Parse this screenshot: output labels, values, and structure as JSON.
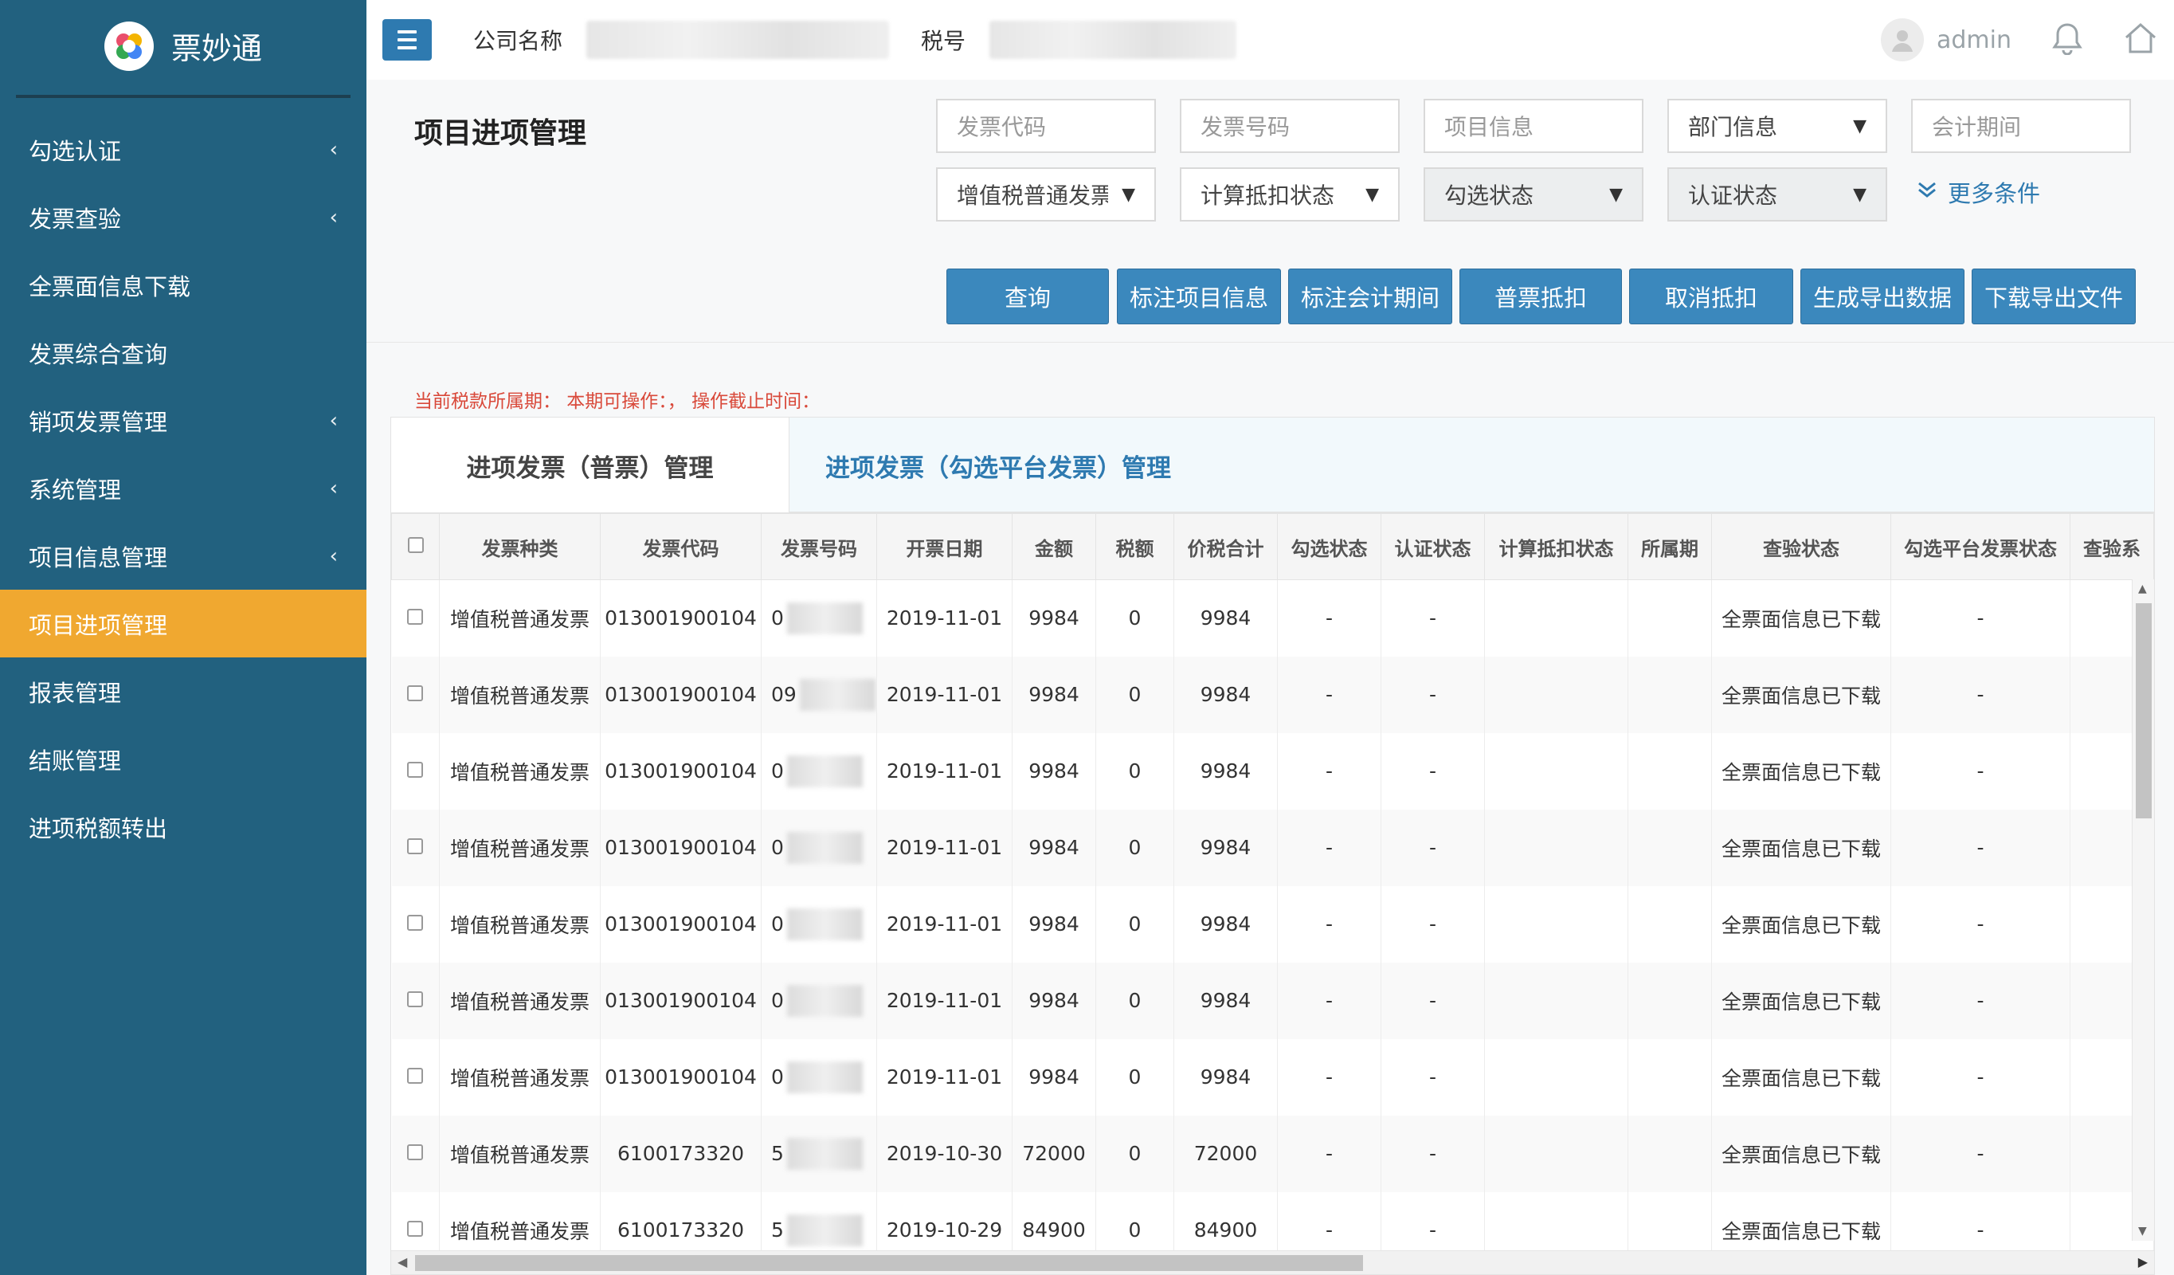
{
  "app": {
    "name": "票妙通"
  },
  "sidebar": {
    "items": [
      {
        "label": "勾选认证",
        "has_children": true
      },
      {
        "label": "发票查验",
        "has_children": true
      },
      {
        "label": "全票面信息下载",
        "has_children": false
      },
      {
        "label": "发票综合查询",
        "has_children": false
      },
      {
        "label": "销项发票管理",
        "has_children": true
      },
      {
        "label": "系统管理",
        "has_children": true
      },
      {
        "label": "项目信息管理",
        "has_children": true
      },
      {
        "label": "项目进项管理",
        "has_children": false,
        "active": true
      },
      {
        "label": "报表管理",
        "has_children": false
      },
      {
        "label": "结账管理",
        "has_children": false
      },
      {
        "label": "进项税额转出",
        "has_children": false
      }
    ]
  },
  "topbar": {
    "company_label": "公司名称",
    "tax_label": "税号",
    "username": "admin"
  },
  "page": {
    "title": "项目进项管理"
  },
  "filters": {
    "invoice_code_placeholder": "发票代码",
    "invoice_number_placeholder": "发票号码",
    "project_info_placeholder": "项目信息",
    "department_select": "部门信息",
    "accounting_period_placeholder": "会计期间",
    "invoice_type_select": "增值税普通发票",
    "deduction_status_select": "计算抵扣状态",
    "check_status_select": "勾选状态",
    "cert_status_select": "认证状态",
    "more_conditions": "更多条件"
  },
  "actions": {
    "query": "查询",
    "mark_project": "标注项目信息",
    "mark_period": "标注会计期间",
    "normal_deduct": "普票抵扣",
    "cancel_deduct": "取消抵扣",
    "generate_export": "生成导出数据",
    "download_export": "下载导出文件"
  },
  "notice": "当前税款所属期： 本期可操作：， 操作截止时间：",
  "tabs": [
    {
      "label": "进项发票（普票）管理",
      "active": true
    },
    {
      "label": "进项发票（勾选平台发票）管理",
      "active": false
    }
  ],
  "table": {
    "columns": [
      "发票种类",
      "发票代码",
      "发票号码",
      "开票日期",
      "金额",
      "税额",
      "价税合计",
      "勾选状态",
      "认证状态",
      "计算抵扣状态",
      "所属期",
      "查验状态",
      "勾选平台发票状态",
      "查验系"
    ],
    "rows": [
      {
        "type": "增值税普通发票",
        "code": "013001900104",
        "number_prefix": "0",
        "date": "2019-11-01",
        "amount": "9984",
        "tax": "0",
        "total": "9984",
        "check": "-",
        "cert": "-",
        "deduct": "",
        "period": "",
        "verify": "全票面信息已下载",
        "platform": "-"
      },
      {
        "type": "增值税普通发票",
        "code": "013001900104",
        "number_prefix": "09",
        "date": "2019-11-01",
        "amount": "9984",
        "tax": "0",
        "total": "9984",
        "check": "-",
        "cert": "-",
        "deduct": "",
        "period": "",
        "verify": "全票面信息已下载",
        "platform": "-"
      },
      {
        "type": "增值税普通发票",
        "code": "013001900104",
        "number_prefix": "0",
        "date": "2019-11-01",
        "amount": "9984",
        "tax": "0",
        "total": "9984",
        "check": "-",
        "cert": "-",
        "deduct": "",
        "period": "",
        "verify": "全票面信息已下载",
        "platform": "-"
      },
      {
        "type": "增值税普通发票",
        "code": "013001900104",
        "number_prefix": "0",
        "date": "2019-11-01",
        "amount": "9984",
        "tax": "0",
        "total": "9984",
        "check": "-",
        "cert": "-",
        "deduct": "",
        "period": "",
        "verify": "全票面信息已下载",
        "platform": "-"
      },
      {
        "type": "增值税普通发票",
        "code": "013001900104",
        "number_prefix": "0",
        "date": "2019-11-01",
        "amount": "9984",
        "tax": "0",
        "total": "9984",
        "check": "-",
        "cert": "-",
        "deduct": "",
        "period": "",
        "verify": "全票面信息已下载",
        "platform": "-"
      },
      {
        "type": "增值税普通发票",
        "code": "013001900104",
        "number_prefix": "0",
        "date": "2019-11-01",
        "amount": "9984",
        "tax": "0",
        "total": "9984",
        "check": "-",
        "cert": "-",
        "deduct": "",
        "period": "",
        "verify": "全票面信息已下载",
        "platform": "-"
      },
      {
        "type": "增值税普通发票",
        "code": "013001900104",
        "number_prefix": "0",
        "date": "2019-11-01",
        "amount": "9984",
        "tax": "0",
        "total": "9984",
        "check": "-",
        "cert": "-",
        "deduct": "",
        "period": "",
        "verify": "全票面信息已下载",
        "platform": "-"
      },
      {
        "type": "增值税普通发票",
        "code": "6100173320",
        "number_prefix": "5",
        "date": "2019-10-30",
        "amount": "72000",
        "tax": "0",
        "total": "72000",
        "check": "-",
        "cert": "-",
        "deduct": "",
        "period": "",
        "verify": "全票面信息已下载",
        "platform": "-"
      },
      {
        "type": "增值税普通发票",
        "code": "6100173320",
        "number_prefix": "5",
        "date": "2019-10-29",
        "amount": "84900",
        "tax": "0",
        "total": "84900",
        "check": "-",
        "cert": "-",
        "deduct": "",
        "period": "",
        "verify": "全票面信息已下载",
        "platform": "-"
      }
    ]
  },
  "colors": {
    "sidebar": "#22617f",
    "active": "#f0a830",
    "primary": "#3b88bd",
    "link": "#2e7ab0",
    "notice": "#d9493a"
  }
}
